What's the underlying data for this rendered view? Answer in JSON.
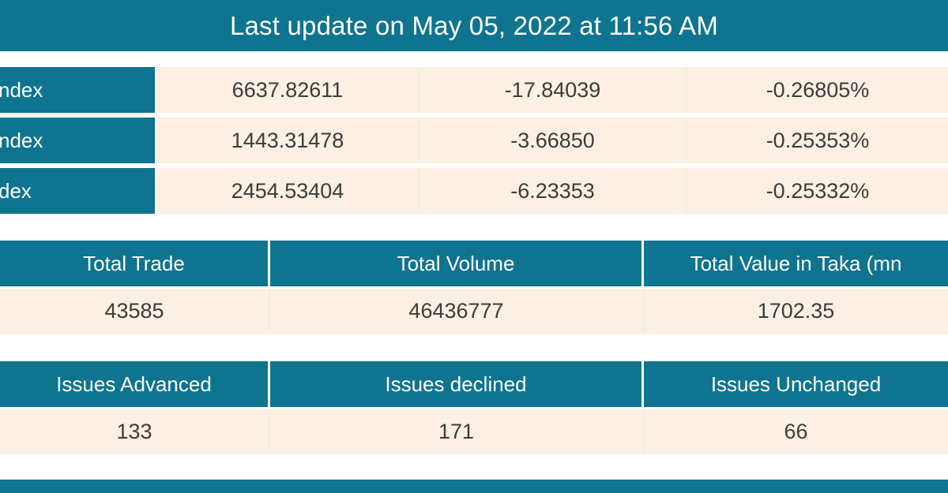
{
  "header": {
    "last_update_label": "Last update on May 05, 2022 at 11:56 AM"
  },
  "colors": {
    "teal": "#0E7490",
    "cream": "#FCEFE3",
    "text_dark": "#3C3C3C",
    "text_light": "#FFFFFF"
  },
  "index_table": {
    "rows": [
      {
        "name": "ndex",
        "value": "6637.82611",
        "change": "-17.84039",
        "percent": "-0.26805%"
      },
      {
        "name": "ndex",
        "value": "1443.31478",
        "change": "-3.66850",
        "percent": "-0.25353%"
      },
      {
        "name": "dex",
        "value": "2454.53404",
        "change": "-6.23353",
        "percent": "-0.25332%"
      }
    ]
  },
  "trade_table": {
    "headers": {
      "total_trade": "Total Trade",
      "total_volume": "Total Volume",
      "total_value": "Total Value in Taka (mn"
    },
    "values": {
      "total_trade": "43585",
      "total_volume": "46436777",
      "total_value": "1702.35"
    }
  },
  "issues_table": {
    "headers": {
      "advanced": "Issues Advanced",
      "declined": "Issues declined",
      "unchanged": "Issues Unchanged"
    },
    "values": {
      "advanced": "133",
      "declined": "171",
      "unchanged": "66"
    }
  }
}
